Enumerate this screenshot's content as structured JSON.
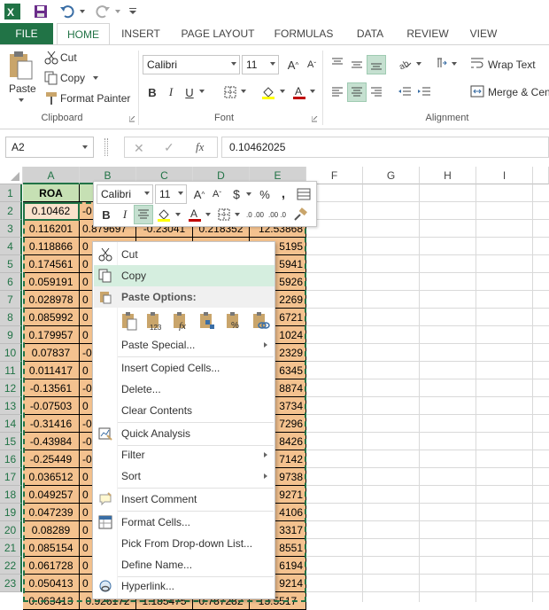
{
  "qat": {
    "excel_icon": "excel-logo",
    "save": "save-icon",
    "undo": "undo-icon",
    "redo": "redo-icon",
    "customize": "customize-icon"
  },
  "tabs": [
    "FILE",
    "HOME",
    "INSERT",
    "PAGE LAYOUT",
    "FORMULAS",
    "DATA",
    "REVIEW",
    "VIEW"
  ],
  "ribbon": {
    "clipboard": {
      "paste": "Paste",
      "cut": "Cut",
      "copy": "Copy",
      "format_painter": "Format Painter",
      "label": "Clipboard"
    },
    "font": {
      "name": "Calibri",
      "size": "11",
      "grow": "A",
      "shrink": "A",
      "bold": "B",
      "italic": "I",
      "underline": "U",
      "label": "Font"
    },
    "alignment": {
      "wrap": "Wrap Text",
      "merge": "Merge & Cen",
      "label": "Alignment"
    }
  },
  "formula_bar": {
    "name_box": "A2",
    "fx": "fx",
    "value": "0.10462025"
  },
  "columns": [
    "A",
    "B",
    "C",
    "D",
    "E",
    "F",
    "G",
    "H",
    "I"
  ],
  "rows": [
    "1",
    "2",
    "3",
    "4",
    "5",
    "6",
    "7",
    "8",
    "9",
    "10",
    "11",
    "12",
    "13",
    "14",
    "15",
    "16",
    "17",
    "18",
    "19",
    "20",
    "21",
    "22",
    "23"
  ],
  "header_cell": "ROA",
  "colA": [
    "0.10462",
    "0.116201",
    "0.118866",
    "0.174561",
    "0.059191",
    "0.028978",
    "0.085992",
    "0.179957",
    "0.07837",
    "0.011417",
    "-0.13561",
    "-0.07503",
    "-0.31416",
    "-0.43984",
    "-0.25449",
    "0.036512",
    "0.049257",
    "0.047239",
    "0.08289",
    "0.085154",
    "0.061728",
    "0.050413"
  ],
  "colB": [
    "-0",
    "0.879697",
    "0",
    "0",
    "0",
    "0",
    "0",
    "0",
    "-0",
    "0",
    "-0",
    "0",
    "-0",
    "-0",
    "-0",
    "0",
    "0",
    "0",
    "0",
    "0",
    "0",
    "0"
  ],
  "colE": [
    "",
    "12.53868",
    "5195",
    "5941",
    "5926",
    "2269",
    "6721",
    "1024",
    "2329",
    "6345",
    "8874",
    "3734",
    "7296",
    "8426",
    "7142",
    "9738",
    "9271",
    "4106",
    "3317",
    "8551",
    "6194",
    "9214"
  ],
  "row3": {
    "c": "-0.23041",
    "d": "0.218352"
  },
  "row24_partial": {
    "a": "0.063413",
    "b": "0.926172",
    "c": "1.185475",
    "d": "0.787282",
    "e": "13.5517"
  },
  "mini_toolbar": {
    "font": "Calibri",
    "size": "11",
    "grow": "A",
    "shrink": "A",
    "currency": "$",
    "percent": "%",
    "comma": ",",
    "bold": "B",
    "italic": "I",
    "font_color": "A",
    "inc_decimal": ".0 .00",
    "dec_decimal": ".00 .0"
  },
  "context_menu": {
    "items": [
      "Cut",
      "Copy",
      "Paste Options:",
      "Paste Special...",
      "Insert Copied Cells...",
      "Delete...",
      "Clear Contents",
      "Quick Analysis",
      "Filter",
      "Sort",
      "Insert Comment",
      "Format Cells...",
      "Pick From Drop-down List...",
      "Define Name...",
      "Hyperlink..."
    ]
  },
  "colors": {
    "excel_green": "#217346",
    "selection_fill": "#f4c28f",
    "header_fill": "#c6e0b4",
    "menu_highlight": "#d5eedf",
    "font_red": "#c00000"
  }
}
